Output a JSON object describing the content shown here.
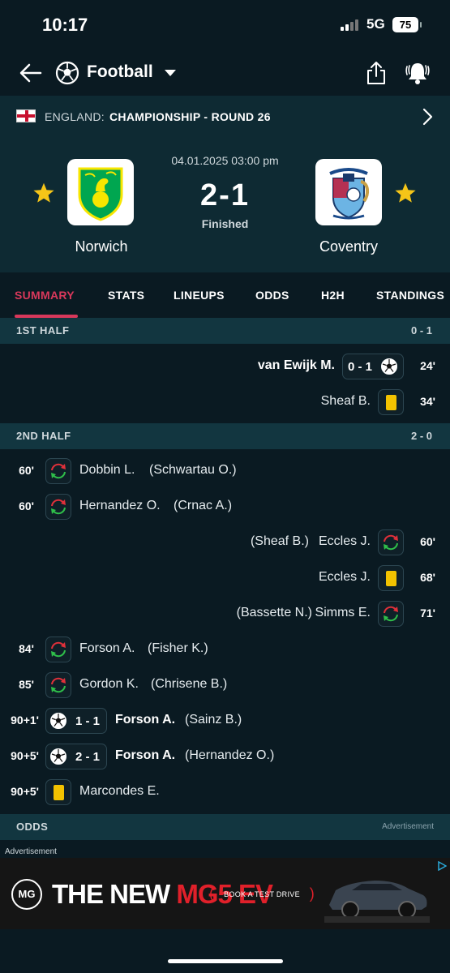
{
  "status_bar": {
    "time": "10:17",
    "network": "5G",
    "battery": "75"
  },
  "header": {
    "sport": "Football"
  },
  "league": {
    "country": "ENGLAND:",
    "name": "CHAMPIONSHIP - ROUND 26"
  },
  "match": {
    "date": "04.01.2025 03:00 pm",
    "score": "2-1",
    "status": "Finished",
    "home_team": "Norwich",
    "away_team": "Coventry"
  },
  "tabs": [
    "SUMMARY",
    "STATS",
    "LINEUPS",
    "ODDS",
    "H2H",
    "STANDINGS"
  ],
  "first_half": {
    "title": "1ST HALF",
    "score": "0 - 1",
    "events": [
      {
        "minute": "24'",
        "player": "van Ewijk M.",
        "score": "0 - 1"
      },
      {
        "minute": "34'",
        "player": "Sheaf B."
      }
    ]
  },
  "second_half": {
    "title": "2ND HALF",
    "score": "2 - 0",
    "events": [
      {
        "minute": "60'",
        "player": "Dobbin L.",
        "assist": "(Schwartau O.)"
      },
      {
        "minute": "60'",
        "player": "Hernandez O.",
        "assist": "(Crnac A.)"
      },
      {
        "minute": "60'",
        "player": "Eccles J.",
        "assist": "(Sheaf B.)"
      },
      {
        "minute": "68'",
        "player": "Eccles J."
      },
      {
        "minute": "71'",
        "player": "Simms E.",
        "assist": "(Bassette N.)"
      },
      {
        "minute": "84'",
        "player": "Forson A.",
        "assist": "(Fisher K.)"
      },
      {
        "minute": "85'",
        "player": "Gordon K.",
        "assist": "(Chrisene B.)"
      },
      {
        "minute": "90+1'",
        "player": "Forson A.",
        "assist": "(Sainz B.)",
        "score": "1 - 1"
      },
      {
        "minute": "90+5'",
        "player": "Forson A.",
        "assist": "(Hernandez O.)",
        "score": "2 - 1"
      },
      {
        "minute": "90+5'",
        "player": "Marcondes E."
      }
    ]
  },
  "odds": {
    "title": "ODDS",
    "ad_note": "Advertisement"
  },
  "ad": {
    "label": "Advertisement",
    "brand": "MG",
    "headline_white": "THE NEW ",
    "headline_red": "MG5 EV",
    "cta": "BOOK A TEST DRIVE"
  },
  "icons": {
    "substitution": "substitution-arrows-icon",
    "goal": "football-icon",
    "card": "yellow-card-icon"
  },
  "colors": {
    "accent": "#d8385b",
    "yellow_card": "#f2c200",
    "sub_in": "#2fbf4a",
    "sub_out": "#e0303a",
    "star": "#f5c518"
  }
}
